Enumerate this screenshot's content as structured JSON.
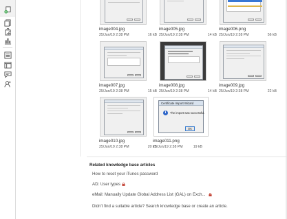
{
  "sidebar": {
    "icons": [
      "add-badge-icon",
      "documents-icon",
      "puzzle-icon",
      "bar-chart-icon",
      "list-icon",
      "pages-icon",
      "chat-icon",
      "user-add-icon"
    ]
  },
  "gallery": {
    "images": [
      {
        "name": "image004.jpg",
        "date": "25/Jun/19 2:38 PM",
        "size": "16 kB"
      },
      {
        "name": "image005.jpg",
        "date": "25/Jun/19 2:38 PM",
        "size": "14 kB"
      },
      {
        "name": "image006.png",
        "date": "25/Jun/19 2:38 PM",
        "size": "56 kB"
      },
      {
        "name": "image007.jpg",
        "date": "25/Jun/19 2:38 PM",
        "size": "15 kB"
      },
      {
        "name": "image008.jpg",
        "date": "25/Jun/19 2:38 PM",
        "size": "14 kB"
      },
      {
        "name": "image009.jpg",
        "date": "25/Jun/19 2:38 PM",
        "size": "22 kB"
      },
      {
        "name": "image010.jpg",
        "date": "25/Jun/19 2:38 PM",
        "size": "20 kB"
      },
      {
        "name": "image011.png",
        "date": "25/Jun/19 2:38 PM",
        "size": "19 kB"
      }
    ],
    "dialog": {
      "title": "Certificate Import Wizard",
      "message": "The import was successful.",
      "ok_label": "OK"
    }
  },
  "related": {
    "heading": "Related knowledge base articles",
    "articles": [
      {
        "title": "How to reset your iTunes password",
        "restricted": false
      },
      {
        "title": "AD: User types",
        "restricted": true
      },
      {
        "title": "eMail: Manually Update Global Address List (GAL) on Exch...",
        "restricted": true
      }
    ],
    "suggest_prefix": "Didn't find a suitable article?",
    "search_link": "Search knowledge base",
    "or_text": "or",
    "create_link": "create an article."
  },
  "colors": {
    "lock": "#c0392b",
    "sidebar_accent": "#3aa54a"
  }
}
